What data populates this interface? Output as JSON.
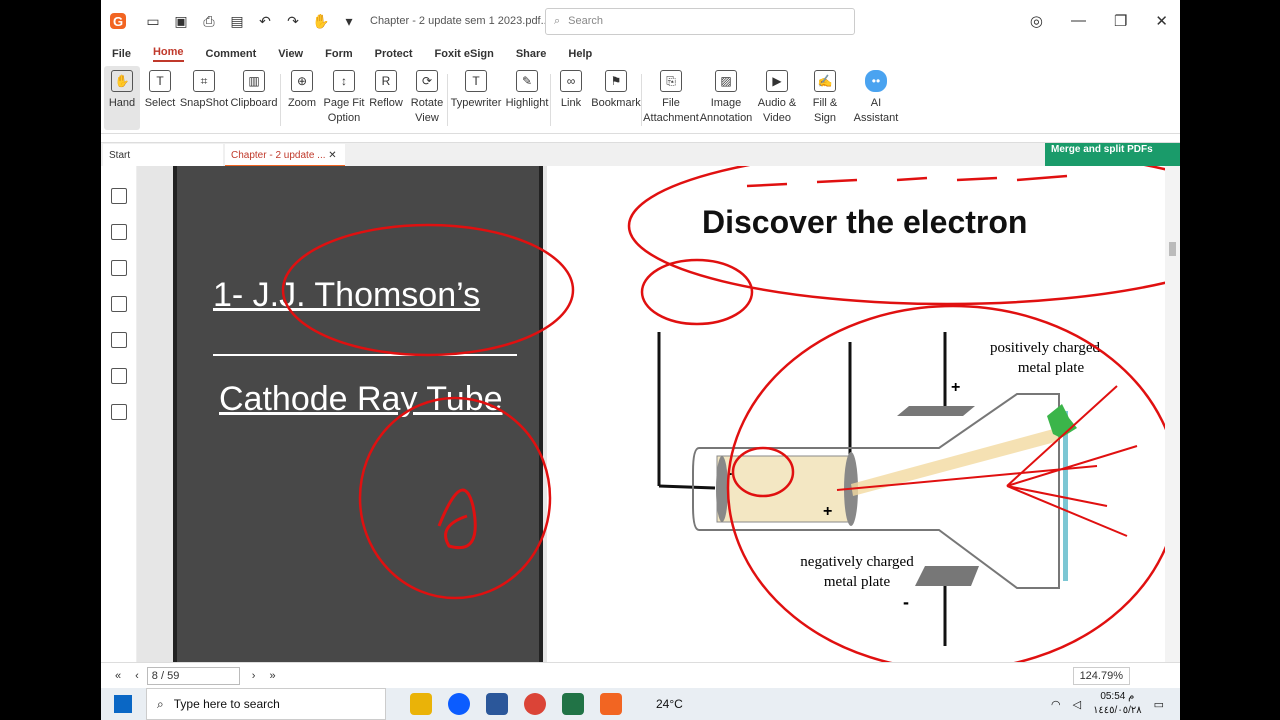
{
  "titlebar": {
    "doc_title": "Chapter - 2 update sem 1 2023.pdf...",
    "search_placeholder": "Search"
  },
  "menu": [
    "File",
    "Home",
    "Comment",
    "View",
    "Form",
    "Protect",
    "Foxit eSign",
    "Share",
    "Help"
  ],
  "ribbon": {
    "hand": "Hand",
    "select": "Select",
    "snapshot": "SnapShot",
    "clipboard": "Clipboard",
    "zoom": "Zoom",
    "pagefit": "Page Fit Option",
    "reflow": "Reflow",
    "rotate": "Rotate View",
    "typewriter": "Typewriter",
    "highlight": "Highlight",
    "link": "Link",
    "bookmark": "Bookmark",
    "file_attachment": "File Attachment",
    "image_annotation": "Image Annotation",
    "audio_video": "Audio & Video",
    "fill_sign": "Fill & Sign",
    "ai": "AI Assistant"
  },
  "tabs": {
    "start": "Start",
    "doc": "Chapter - 2 update ..."
  },
  "promo": "Merge and split PDFs",
  "slide_left": {
    "title": "1- J.J. Thomson’s",
    "subtitle": "Cathode Ray Tube"
  },
  "slide_right": {
    "heading": "Discover the electron",
    "label_pos": "positively charged",
    "label_pos2": "metal plate",
    "label_neg": "negatively charged",
    "label_neg2": "metal plate",
    "plus": "+",
    "minus": "-"
  },
  "status": {
    "page": "8 / 59",
    "zoom": "124.79%"
  },
  "taskbar": {
    "search": "Type here to search",
    "temp": "24°C",
    "time": "05:54 م",
    "date": "١٤٤٥/٠٥/٢٨"
  }
}
